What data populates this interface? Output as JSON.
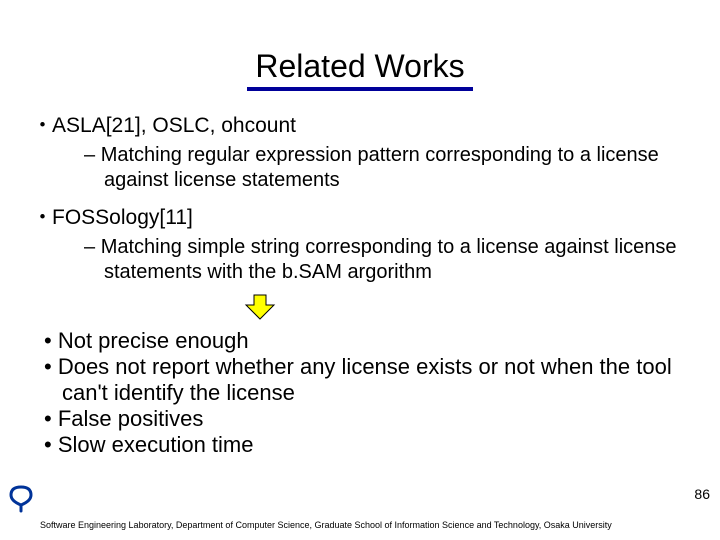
{
  "title": "Related Works",
  "items": [
    {
      "label": "ASLA[21], OSLC, ohcount",
      "sub": "Matching regular expression pattern corresponding to a license against license statements"
    },
    {
      "label": "FOSSology[11]",
      "sub": "Matching simple string corresponding to a license against license statements with the b.SAM argorithm"
    }
  ],
  "conclusions": [
    "Not precise enough",
    "Does not report whether any license exists or not when the tool can't identify the license",
    "False positives",
    "Slow execution time"
  ],
  "page_number": "86",
  "footer": "Software Engineering Laboratory, Department of Computer Science, Graduate School of Information Science and Technology, Osaka University"
}
